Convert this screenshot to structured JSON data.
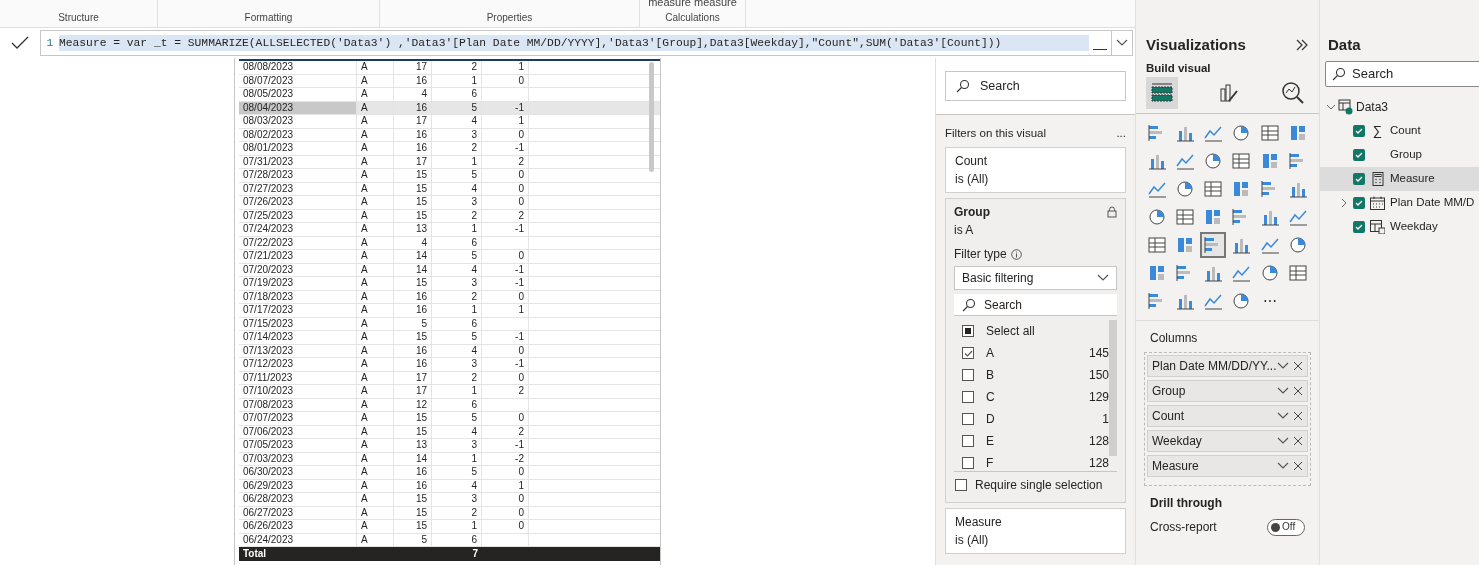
{
  "ribbon": {
    "sections": [
      {
        "label": "Structure"
      },
      {
        "label": "Formatting"
      },
      {
        "label": "Properties"
      },
      {
        "label": "Calculations",
        "above": "measure measure"
      }
    ]
  },
  "formula_bar": {
    "line_number": "1",
    "text": "Measure = var _t = SUMMARIZE(ALLSELECTED('Data3') ,'Data3'[Plan Date MM/DD/YYYY],'Data3'[Group],Data3[Weekday],\"Count\",SUM('Data3'[Count]))"
  },
  "table": {
    "rows": [
      {
        "cells": [
          "08/08/2023",
          "A",
          "17",
          "2",
          "1"
        ],
        "selected": false
      },
      {
        "cells": [
          "08/07/2023",
          "A",
          "16",
          "1",
          "0"
        ],
        "selected": false
      },
      {
        "cells": [
          "08/05/2023",
          "A",
          "4",
          "6",
          null
        ],
        "selected": false
      },
      {
        "cells": [
          "08/04/2023",
          "A",
          "16",
          "5",
          "-1"
        ],
        "selected": true
      },
      {
        "cells": [
          "08/03/2023",
          "A",
          "17",
          "4",
          "1"
        ],
        "selected": false
      },
      {
        "cells": [
          "08/02/2023",
          "A",
          "16",
          "3",
          "0"
        ],
        "selected": false
      },
      {
        "cells": [
          "08/01/2023",
          "A",
          "16",
          "2",
          "-1"
        ],
        "selected": false
      },
      {
        "cells": [
          "07/31/2023",
          "A",
          "17",
          "1",
          "2"
        ],
        "selected": false
      },
      {
        "cells": [
          "07/28/2023",
          "A",
          "15",
          "5",
          "0"
        ],
        "selected": false
      },
      {
        "cells": [
          "07/27/2023",
          "A",
          "15",
          "4",
          "0"
        ],
        "selected": false
      },
      {
        "cells": [
          "07/26/2023",
          "A",
          "15",
          "3",
          "0"
        ],
        "selected": false
      },
      {
        "cells": [
          "07/25/2023",
          "A",
          "15",
          "2",
          "2"
        ],
        "selected": false
      },
      {
        "cells": [
          "07/24/2023",
          "A",
          "13",
          "1",
          "-1"
        ],
        "selected": false
      },
      {
        "cells": [
          "07/22/2023",
          "A",
          "4",
          "6",
          null
        ],
        "selected": false
      },
      {
        "cells": [
          "07/21/2023",
          "A",
          "14",
          "5",
          "0"
        ],
        "selected": false
      },
      {
        "cells": [
          "07/20/2023",
          "A",
          "14",
          "4",
          "-1"
        ],
        "selected": false
      },
      {
        "cells": [
          "07/19/2023",
          "A",
          "15",
          "3",
          "-1"
        ],
        "selected": false
      },
      {
        "cells": [
          "07/18/2023",
          "A",
          "16",
          "2",
          "0"
        ],
        "selected": false
      },
      {
        "cells": [
          "07/17/2023",
          "A",
          "16",
          "1",
          "1"
        ],
        "selected": false
      },
      {
        "cells": [
          "07/15/2023",
          "A",
          "5",
          "6",
          null
        ],
        "selected": false
      },
      {
        "cells": [
          "07/14/2023",
          "A",
          "15",
          "5",
          "-1"
        ],
        "selected": false
      },
      {
        "cells": [
          "07/13/2023",
          "A",
          "16",
          "4",
          "0"
        ],
        "selected": false
      },
      {
        "cells": [
          "07/12/2023",
          "A",
          "16",
          "3",
          "-1"
        ],
        "selected": false
      },
      {
        "cells": [
          "07/11/2023",
          "A",
          "17",
          "2",
          "0"
        ],
        "selected": false
      },
      {
        "cells": [
          "07/10/2023",
          "A",
          "17",
          "1",
          "2"
        ],
        "selected": false
      },
      {
        "cells": [
          "07/08/2023",
          "A",
          "12",
          "6",
          null
        ],
        "selected": false
      },
      {
        "cells": [
          "07/07/2023",
          "A",
          "15",
          "5",
          "0"
        ],
        "selected": false
      },
      {
        "cells": [
          "07/06/2023",
          "A",
          "15",
          "4",
          "2"
        ],
        "selected": false
      },
      {
        "cells": [
          "07/05/2023",
          "A",
          "13",
          "3",
          "-1"
        ],
        "selected": false
      },
      {
        "cells": [
          "07/03/2023",
          "A",
          "14",
          "1",
          "-2"
        ],
        "selected": false
      },
      {
        "cells": [
          "06/30/2023",
          "A",
          "16",
          "5",
          "0"
        ],
        "selected": false
      },
      {
        "cells": [
          "06/29/2023",
          "A",
          "16",
          "4",
          "1"
        ],
        "selected": false
      },
      {
        "cells": [
          "06/28/2023",
          "A",
          "15",
          "3",
          "0"
        ],
        "selected": false
      },
      {
        "cells": [
          "06/27/2023",
          "A",
          "15",
          "2",
          "0"
        ],
        "selected": false
      },
      {
        "cells": [
          "06/26/2023",
          "A",
          "15",
          "1",
          "0"
        ],
        "selected": false
      },
      {
        "cells": [
          "06/24/2023",
          "A",
          "5",
          "6",
          null
        ],
        "selected": false
      }
    ],
    "total": {
      "label": "Total",
      "value": "7"
    }
  },
  "filters": {
    "search": {
      "placeholder": "Search"
    },
    "title": "Filters on this visual",
    "more": "...",
    "cards": [
      {
        "kind": "collapsed",
        "field": "Count",
        "condition": "is (All)"
      },
      {
        "kind": "expanded",
        "field": "Group",
        "condition": "is A",
        "filter_type_label": "Filter type",
        "filter_type": "Basic filtering",
        "search_placeholder": "Search",
        "items": [
          {
            "label": "Select all",
            "kind": "select_all",
            "indeterminate": true
          },
          {
            "label": "A",
            "kind": "value",
            "count": "145",
            "checked": true
          },
          {
            "label": "B",
            "kind": "value",
            "count": "150",
            "checked": false
          },
          {
            "label": "C",
            "kind": "value",
            "count": "129",
            "checked": false
          },
          {
            "label": "D",
            "kind": "value",
            "count": "1",
            "checked": false
          },
          {
            "label": "E",
            "kind": "value",
            "count": "128",
            "checked": false
          },
          {
            "label": "F",
            "kind": "value",
            "count": "128",
            "checked": false
          }
        ],
        "require_single": {
          "label": "Require single selection",
          "checked": false
        }
      },
      {
        "kind": "collapsed",
        "field": "Measure",
        "condition": "is (All)"
      }
    ]
  },
  "visualizations": {
    "title": "Visualizations",
    "build_label": "Build visual",
    "modes": [
      {
        "selected": true
      },
      {
        "selected": false
      },
      {
        "selected": false
      }
    ],
    "types": [
      {
        "selected": false
      },
      {
        "selected": false
      },
      {
        "selected": false
      },
      {
        "selected": false
      },
      {
        "selected": false
      },
      {
        "selected": false
      },
      {
        "selected": false
      },
      {
        "selected": false
      },
      {
        "selected": false
      },
      {
        "selected": false
      },
      {
        "selected": false
      },
      {
        "selected": false
      },
      {
        "selected": false
      },
      {
        "selected": false
      },
      {
        "selected": false
      },
      {
        "selected": false
      },
      {
        "selected": false
      },
      {
        "selected": false
      },
      {
        "selected": false
      },
      {
        "selected": false
      },
      {
        "selected": false
      },
      {
        "selected": false
      },
      {
        "selected": false
      },
      {
        "selected": false
      },
      {
        "selected": false
      },
      {
        "selected": false
      },
      {
        "selected": true
      },
      {
        "selected": false
      },
      {
        "selected": false
      },
      {
        "selected": false
      },
      {
        "selected": false
      },
      {
        "selected": false
      },
      {
        "selected": false
      },
      {
        "selected": false
      },
      {
        "selected": false
      },
      {
        "selected": false
      },
      {
        "selected": false
      },
      {
        "selected": false
      },
      {
        "selected": false
      },
      {
        "selected": false
      }
    ],
    "more": "⋯",
    "columns_label": "Columns",
    "columns": [
      "Plan Date MM/DD/YY...",
      "Group",
      "Count",
      "Weekday",
      "Measure"
    ],
    "drill_label": "Drill through",
    "cross_report": {
      "label": "Cross-report",
      "on": false,
      "state_text": "Off"
    }
  },
  "data": {
    "title": "Data",
    "search": {
      "placeholder": "Search"
    },
    "tree": [
      {
        "label": "Data3",
        "kind": "table",
        "expanded": true,
        "children": [
          {
            "label": "Count",
            "kind": "sum",
            "icon_text": "∑",
            "checked": true,
            "selected": false
          },
          {
            "label": "Group",
            "kind": "text",
            "checked": true,
            "selected": false
          },
          {
            "label": "Measure",
            "kind": "measure",
            "checked": true,
            "selected": true
          },
          {
            "label": "Plan Date MM/D",
            "kind": "date",
            "checked": true,
            "selected": false,
            "expanded": false
          },
          {
            "label": "Weekday",
            "kind": "column",
            "checked": true,
            "selected": false
          }
        ]
      }
    ]
  }
}
